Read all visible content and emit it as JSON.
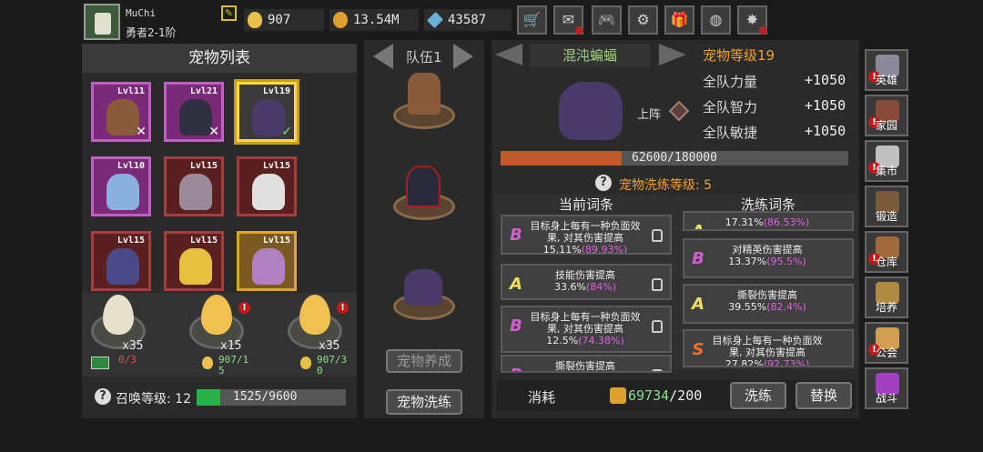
{
  "player": {
    "name": "MuChi",
    "rank": "勇者2-1阶"
  },
  "resources": [
    {
      "name": "egg-currency",
      "value": "907",
      "color": "#e8c04a"
    },
    {
      "name": "gold-coin",
      "value": "13.54M",
      "color": "#e0a030"
    },
    {
      "name": "diamond",
      "value": "43587",
      "color": "#6ab0d8"
    }
  ],
  "top_buttons": [
    "shop-cart-icon",
    "mail-icon",
    "gamepad-icon",
    "gear-icon",
    "gift-icon",
    "colorwheel-icon",
    "firework-icon"
  ],
  "pet_list": {
    "title": "宠物列表",
    "pets": [
      {
        "level": "Lvl11",
        "mark": "✕",
        "frame": "purple",
        "color": "#8a5a3a"
      },
      {
        "level": "Lvl21",
        "mark": "✕",
        "frame": "purple",
        "color": "#303040"
      },
      {
        "level": "Lvl19",
        "mark": "✓",
        "frame": "selected",
        "color": "#4a3a6a"
      },
      {
        "level": "Lvl10",
        "mark": "",
        "frame": "purple",
        "color": "#8ab0e0"
      },
      {
        "level": "Lvl15",
        "mark": "",
        "frame": "red",
        "color": "#9a8a9a"
      },
      {
        "level": "Lvl15",
        "mark": "",
        "frame": "red",
        "color": "#e0e0e0"
      },
      {
        "level": "Lvl15",
        "mark": "",
        "frame": "red",
        "color": "#4a4a8a"
      },
      {
        "level": "Lvl15",
        "mark": "",
        "frame": "red",
        "color": "#e8c040"
      },
      {
        "level": "Lvl15",
        "mark": "",
        "frame": "gold",
        "color": "#b080c0"
      }
    ]
  },
  "eggs": [
    {
      "count": "x35",
      "color": "#e8e0c8",
      "cost": "0/3",
      "cost_color": "#e05050"
    },
    {
      "count": "x15",
      "color": "#f0c050",
      "cost": "907/15",
      "cost_color": "#8ce08c"
    },
    {
      "count": "x35",
      "color": "#f0c050",
      "cost": "907/30",
      "cost_color": "#8ce08c"
    }
  ],
  "summon": {
    "label": "召唤等级: 12",
    "progress_text": "1525/9600",
    "progress": 0.159
  },
  "team": {
    "title": "队伍1",
    "feed_button": "宠物养成",
    "wash_button": "宠物洗练"
  },
  "pet_detail": {
    "name": "混沌蝙蝠",
    "level_label": "宠物等级19",
    "deploy": "上阵",
    "stats": [
      {
        "label": "全队力量",
        "value": "+1050"
      },
      {
        "label": "全队智力",
        "value": "+1050"
      },
      {
        "label": "全队敏捷",
        "value": "+1050"
      }
    ],
    "exp_text": "62600/180000",
    "exp": 0.348,
    "refine_level": "宠物洗练等级: 5"
  },
  "entries": {
    "current_title": "当前词条",
    "refine_title": "洗练词条",
    "current": [
      {
        "grade": "B",
        "text": "目标身上每有一种负面效果, 对其伤害提高",
        "val": "15.11%",
        "pct": "(89.93%)"
      },
      {
        "grade": "A",
        "text": "技能伤害提高",
        "val": "33.6%",
        "pct": "(84%)"
      },
      {
        "grade": "B",
        "text": "目标身上每有一种负面效果, 对其伤害提高",
        "val": "12.5%",
        "pct": "(74.38%)"
      },
      {
        "grade": "B",
        "text": "撕裂伤害提高",
        "val": "",
        "pct": ""
      }
    ],
    "refine": [
      {
        "grade": "A",
        "text": "",
        "val": "17.31%",
        "pct": "(86.53%)"
      },
      {
        "grade": "B",
        "text": "对精英伤害提高",
        "val": "13.37%",
        "pct": "(95.5%)"
      },
      {
        "grade": "A",
        "text": "撕裂伤害提高",
        "val": "39.55%",
        "pct": "(82.4%)"
      },
      {
        "grade": "S",
        "text": "目标身上每有一种负面效果, 对其伤害提高",
        "val": "27.82%",
        "pct": "(92.73%)"
      }
    ]
  },
  "cost": {
    "label": "消耗",
    "value": "69734/200",
    "wash_button": "洗练",
    "replace_button": "替换"
  },
  "side_nav": [
    {
      "label": "英雄",
      "color": "#8a8a9a",
      "alert": true
    },
    {
      "label": "家园",
      "color": "#8a4a3a",
      "alert": true
    },
    {
      "label": "集市",
      "color": "#c0c0c0",
      "alert": true
    },
    {
      "label": "锻造",
      "color": "#7a5a3a",
      "alert": false
    },
    {
      "label": "仓库",
      "color": "#a06a3a",
      "alert": true
    },
    {
      "label": "培养",
      "color": "#b08a40",
      "alert": false
    },
    {
      "label": "公会",
      "color": "#d0a050",
      "alert": true
    },
    {
      "label": "战斗",
      "color": "#a040c0",
      "alert": false
    }
  ]
}
